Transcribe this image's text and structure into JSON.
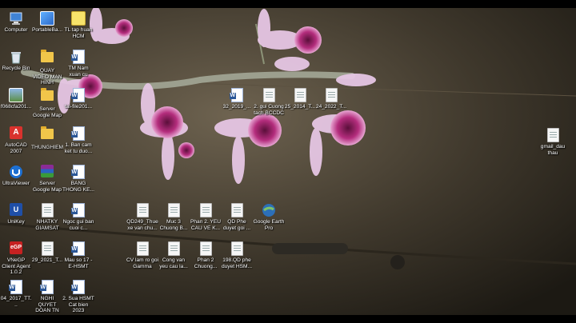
{
  "desktop": {
    "icons": [
      {
        "label": "Computer",
        "icon": "computer-icon"
      },
      {
        "label": "PortableBa...",
        "icon": "app-icon"
      },
      {
        "label": "TL tap huan HCM",
        "icon": "notes-icon"
      },
      {
        "label": "Recycle Bin",
        "icon": "recycle-bin-icon"
      },
      {
        "label": "QUAY VIDEO MAN HINH",
        "icon": "folder-icon"
      },
      {
        "label": "TM Nam xuan cu",
        "icon": "word-doc-icon"
      },
      {
        "label": "f068cfa201...",
        "icon": "image-icon"
      },
      {
        "label": "Server Google Map",
        "icon": "folder-icon"
      },
      {
        "label": "tai-file201...",
        "icon": "word-doc-icon"
      },
      {
        "label": "AutoCAD 2007",
        "icon": "autocad-icon"
      },
      {
        "label": "THUNGHIEM",
        "icon": "folder-icon"
      },
      {
        "label": "1. Ban cam ket tu duo...",
        "icon": "word-doc-icon"
      },
      {
        "label": "UltraViewer",
        "icon": "ultraviewer-icon"
      },
      {
        "label": "Server Google Map",
        "icon": "winrar-icon"
      },
      {
        "label": "BANG THONG KE...",
        "icon": "word-doc-icon"
      },
      {
        "label": "UniKey",
        "icon": "unikey-icon"
      },
      {
        "label": "NHATKY GIAMSAT",
        "icon": "document-icon"
      },
      {
        "label": "Ngoc gui ban cuoi c...",
        "icon": "word-doc-icon"
      },
      {
        "label": "VNeGP Client Agent 1.0.2",
        "icon": "vnegp-icon"
      },
      {
        "label": "29_2021_T...",
        "icon": "document-icon"
      },
      {
        "label": "Mau so 17 -E-HSMT",
        "icon": "word-doc-icon"
      },
      {
        "label": "04_2017_TT...",
        "icon": "word-doc-icon"
      },
      {
        "label": "NGHI QUYET DOAN TN",
        "icon": "word-doc-icon"
      },
      {
        "label": "2. Sua HSMT Cat bien 2023",
        "icon": "word-doc-icon"
      },
      {
        "label": "32_2019_...",
        "icon": "word-doc-icon"
      },
      {
        "label": "2. gui Cuong tach BCCDC",
        "icon": "document-icon"
      },
      {
        "label": "25_2014_T...",
        "icon": "document-icon"
      },
      {
        "label": "24_2022_T...",
        "icon": "document-icon"
      },
      {
        "label": "QD249_Thue xe van chu...",
        "icon": "document-icon"
      },
      {
        "label": "Muc 3 Chuong B...",
        "icon": "document-icon"
      },
      {
        "label": "Phan 2. YEU CAU VE K...",
        "icon": "document-icon"
      },
      {
        "label": "QD Phe duyet goi ...",
        "icon": "document-icon"
      },
      {
        "label": "Google Earth Pro",
        "icon": "google-earth-icon"
      },
      {
        "label": "CV lam ro goi Gamma",
        "icon": "document-icon"
      },
      {
        "label": "Cong van yeu cau la...",
        "icon": "document-icon"
      },
      {
        "label": "Phan 2 Chuong...",
        "icon": "document-icon"
      },
      {
        "label": "198.QD phe duyet HSM...",
        "icon": "document-icon"
      },
      {
        "label": "gmail_dau thau",
        "icon": "document-icon"
      }
    ]
  }
}
